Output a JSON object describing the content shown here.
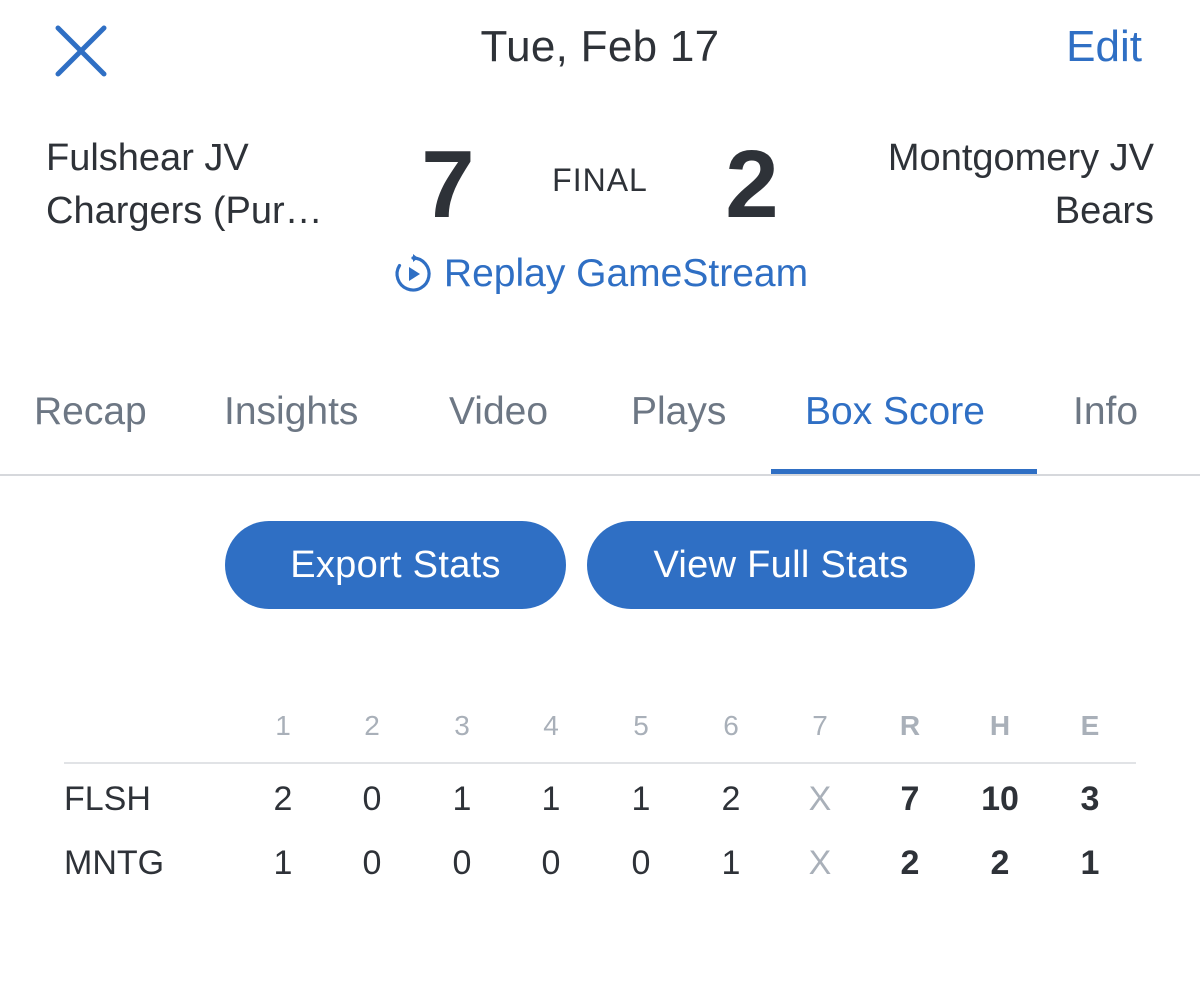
{
  "header": {
    "date": "Tue, Feb 17",
    "edit_label": "Edit"
  },
  "game": {
    "home_team_line1": "Fulshear JV",
    "home_team_line2": "Chargers (Pur…",
    "home_score": "7",
    "status": "FINAL",
    "away_score": "2",
    "away_team_line1": "Montgomery JV",
    "away_team_line2": "Bears",
    "replay_label": "Replay GameStream"
  },
  "tabs": [
    {
      "label": "Recap"
    },
    {
      "label": "Insights"
    },
    {
      "label": "Video"
    },
    {
      "label": "Plays"
    },
    {
      "label": "Box Score"
    },
    {
      "label": "Info"
    }
  ],
  "active_tab": "Box Score",
  "actions": {
    "export_label": "Export Stats",
    "full_stats_label": "View Full Stats"
  },
  "box_score": {
    "columns": [
      "1",
      "2",
      "3",
      "4",
      "5",
      "6",
      "7",
      "R",
      "H",
      "E"
    ],
    "rows": [
      {
        "team": "FLSH",
        "values": [
          "2",
          "0",
          "1",
          "1",
          "1",
          "2",
          "X",
          "7",
          "10",
          "3"
        ]
      },
      {
        "team": "MNTG",
        "values": [
          "1",
          "0",
          "0",
          "0",
          "0",
          "1",
          "X",
          "2",
          "2",
          "1"
        ]
      }
    ]
  },
  "colors": {
    "accent": "#2f6fc4",
    "text": "#2e3238",
    "muted": "#6d7784",
    "faint": "#a9b0b9"
  },
  "icons": {
    "close": "close-icon",
    "replay": "replay-icon"
  }
}
